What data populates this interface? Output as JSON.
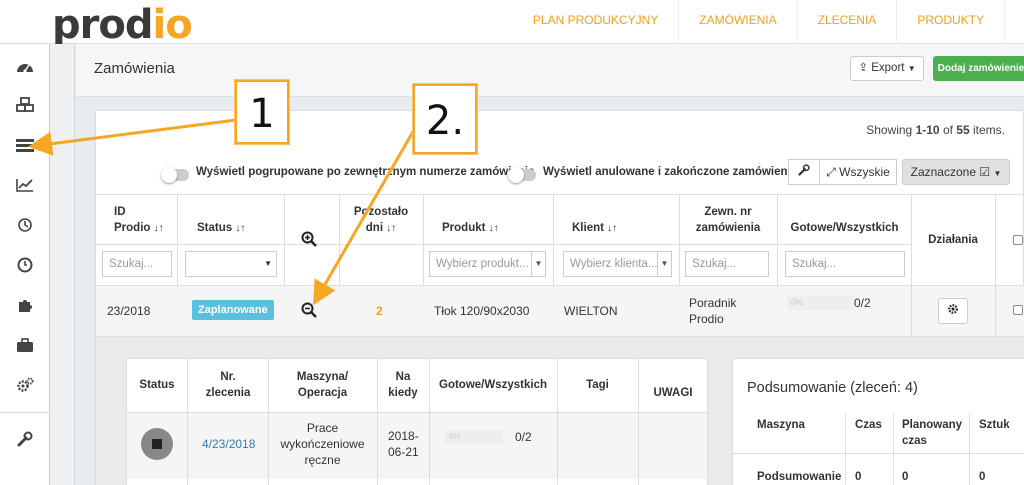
{
  "app": {
    "logo_main": "prod",
    "logo_accent": "io"
  },
  "nav": [
    "PLAN PRODUKCYJNY",
    "ZAMÓWIENIA",
    "ZLECENIA",
    "PRODUKTY"
  ],
  "sidebar_icons": [
    "dashboard-icon",
    "cubes-icon",
    "orders-list-icon",
    "chart-icon",
    "history-icon",
    "clock-icon",
    "puzzle-icon",
    "briefcase-icon",
    "cogs-icon",
    "wrench-icon"
  ],
  "page": {
    "title": "Zamówienia",
    "export_label": "Export",
    "add_label": "Dodaj zamówienie"
  },
  "summary_bar": {
    "prefix": "Showing ",
    "range": "1-10",
    "of_text": " of ",
    "total": "55",
    "suffix": " items."
  },
  "toggles": {
    "group_label": "Wyświetl pogrupowane po zewnętrznym numerze zamówienia",
    "cancelled_label": "Wyświetl anulowane i zakończone zamówienia"
  },
  "toolbar": {
    "all_label": "Wszyskie",
    "selected_label": "Zaznaczone"
  },
  "table": {
    "headers": {
      "id_l1": "ID",
      "id_l2": "Prodio",
      "status": "Status",
      "remaining_l1": "Pozostało",
      "remaining_l2": "dni",
      "product": "Produkt",
      "client": "Klient",
      "ext_l1": "Zewn. nr",
      "ext_l2": "zamówienia",
      "ready": "Gotowe/Wszystkich",
      "actions": "Działania"
    },
    "filters": {
      "id_placeholder": "Szukaj...",
      "product_placeholder": "Wybierz produkt...",
      "client_placeholder": "Wybierz klienta...",
      "ext_placeholder": "Szukaj...",
      "ready_placeholder": "Szukaj..."
    },
    "row": {
      "id": "23/2018",
      "status": "Zaplanowane",
      "remaining": "2",
      "product": "Tłok 120/90x2030",
      "client": "WIELTON",
      "ext_l1": "Poradnik",
      "ext_l2": "Prodio",
      "progress_label": "0%",
      "progress_value": 0,
      "ready": "0/2"
    }
  },
  "sub_table": {
    "headers": {
      "status": "Status",
      "nr_l1": "Nr.",
      "nr_l2": "zlecenia",
      "machine_l1": "Maszyna/",
      "machine_l2": "Operacja",
      "when_l1": "Na",
      "when_l2": "kiedy",
      "ready": "Gotowe/Wszystkich",
      "tags": "Tagi",
      "notes": "UWAGI"
    },
    "row": {
      "nr": "4/23/2018",
      "machine_l1": "Prace",
      "machine_l2": "wykończeniowe",
      "machine_l3": "ręczne",
      "when_l1": "2018-",
      "when_l2": "06-21",
      "progress_label": "0%",
      "ready": "0/2"
    }
  },
  "summary": {
    "title": "Podsumowanie (zleceń: 4)",
    "headers": {
      "machine": "Maszyna",
      "time": "Czas",
      "planned_l1": "Planowany",
      "planned_l2": "czas",
      "pieces": "Sztuk"
    },
    "row": {
      "label": "Podsumowanie",
      "time": "0",
      "planned": "0",
      "pieces": "0"
    }
  },
  "callouts": {
    "one": "1",
    "two": "2."
  },
  "colors": {
    "accent": "#f5a623",
    "nav_text": "#f0a020",
    "success": "#4caf50",
    "info": "#5bc0de",
    "link": "#337ab7"
  }
}
